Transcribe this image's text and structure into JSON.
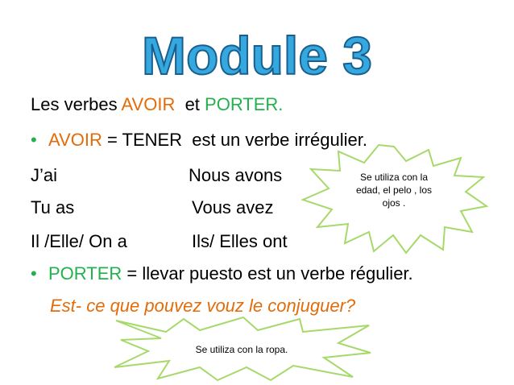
{
  "title": "Module 3",
  "colors": {
    "title_fill": "#35a8e0",
    "title_stroke": "#1a5f8c",
    "accent_green": "#22b14c",
    "accent_orange": "#e36c09",
    "burst_stroke": "#a6d96a"
  },
  "lines": {
    "line1": {
      "prefix": "Les verbes ",
      "avoir": "AVOIR",
      "mid": "  et ",
      "porter": "PORTER."
    },
    "line2": {
      "bullet": "•",
      "avoir": "AVOIR",
      "rest": " = TENER  est un verbe irrégulier."
    },
    "conjugation": [
      {
        "singular": "J’ai",
        "plural": "Nous avons"
      },
      {
        "singular": "Tu as",
        "plural": "Vous avez"
      },
      {
        "singular": "Il /Elle/ On a",
        "plural": "Ils/ Elles ont"
      }
    ],
    "line6": {
      "bullet": "•",
      "porter": "PORTER",
      "rest": " = llevar puesto est un verbe régulier."
    },
    "question": "Est- ce que pouvez vouz le conjuguer?"
  },
  "callouts": {
    "avoir_note": [
      "Se utiliza con la",
      "edad, el pelo , los",
      "ojos ."
    ],
    "porter_note": "Se utiliza con la ropa."
  }
}
